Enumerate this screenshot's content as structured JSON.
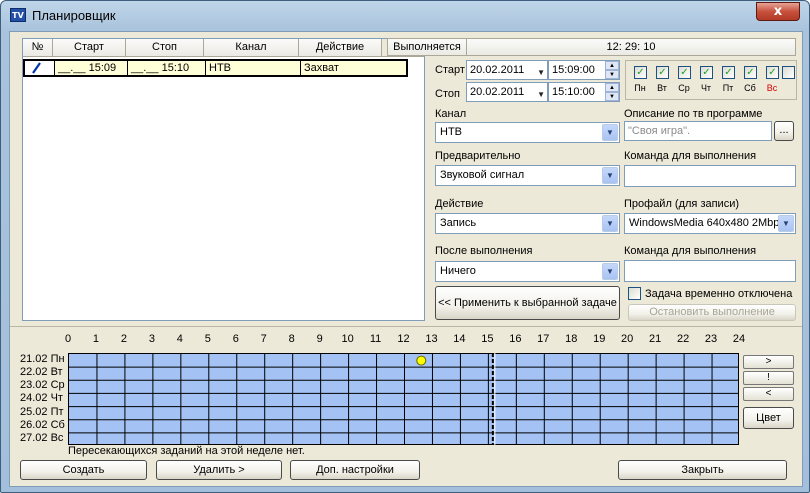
{
  "window": {
    "title": "Планировщик",
    "app_icon": "TV",
    "close_glyph": "x"
  },
  "table": {
    "headers": [
      "№",
      "Старт",
      "Стоп",
      "Канал",
      "Действие",
      "Выполняется"
    ],
    "clock": "12: 29: 10",
    "rows": [
      {
        "edit_icon": "pencil-icon",
        "start": "__.__  15:09",
        "stop": "__.__  15:10",
        "channel": "НТВ",
        "action": "Захват"
      }
    ]
  },
  "schedule": {
    "start_label": "Старт",
    "start_date": "20.02.2011",
    "start_time": "15:09:00",
    "stop_label": "Стоп",
    "stop_date": "20.02.2011",
    "stop_time": "15:10:00",
    "days": [
      {
        "name": "Пн",
        "checked": true,
        "weekend": false
      },
      {
        "name": "Вт",
        "checked": true,
        "weekend": false
      },
      {
        "name": "Ср",
        "checked": true,
        "weekend": false
      },
      {
        "name": "Чт",
        "checked": true,
        "weekend": false
      },
      {
        "name": "Пт",
        "checked": true,
        "weekend": false
      },
      {
        "name": "Сб",
        "checked": true,
        "weekend": false
      },
      {
        "name": "Вс",
        "checked": true,
        "weekend": true
      }
    ],
    "all_days_checked": false
  },
  "form": {
    "channel_label": "Канал",
    "channel_value": "НТВ",
    "description_label": "Описание по тв программе",
    "description_value": "\"Своя игра\".",
    "browse_label": "...",
    "pre_label": "Предварительно",
    "pre_value": "Звуковой сигнал",
    "cmd1_label": "Команда для выполнения",
    "cmd1_value": "",
    "action_label": "Действие",
    "action_value": "Запись",
    "profile_label": "Профайл (для записи)",
    "profile_value": "WindowsMedia 640x480 2Mbp:",
    "after_label": "После выполнения",
    "after_value": "Ничего",
    "cmd2_label": "Команда для выполнения",
    "cmd2_value": "",
    "apply_button": "<< Применить к выбранной задаче",
    "disable_label": "Задача временно отключена",
    "disable_checked": false,
    "stop_button": "Остановить выполнение"
  },
  "grid": {
    "hours": [
      "0",
      "1",
      "2",
      "3",
      "4",
      "5",
      "6",
      "7",
      "8",
      "9",
      "10",
      "11",
      "12",
      "13",
      "14",
      "15",
      "16",
      "17",
      "18",
      "19",
      "20",
      "21",
      "22",
      "23",
      "24"
    ],
    "days": [
      "21.02 Пн",
      "22.02 Вт",
      "23.02 Ср",
      "24.02 Чт",
      "25.02 Пт",
      "26.02 Сб",
      "27.02 Вс"
    ],
    "current_time_hours": 15.16,
    "task_marker_hour": 12.6,
    "task_marker_day": 0,
    "status_text": "Пересекающихся заданий на этой неделе нет.",
    "nav_next": ">",
    "nav_mid": "!",
    "nav_prev": "<",
    "color_button": "Цвет",
    "grid_color": "#a4c2f4",
    "marker_color": "#ffff00"
  },
  "footer": {
    "create": "Создать",
    "delete": "Удалить >",
    "extra": "Доп. настройки",
    "close": "Закрыть"
  }
}
